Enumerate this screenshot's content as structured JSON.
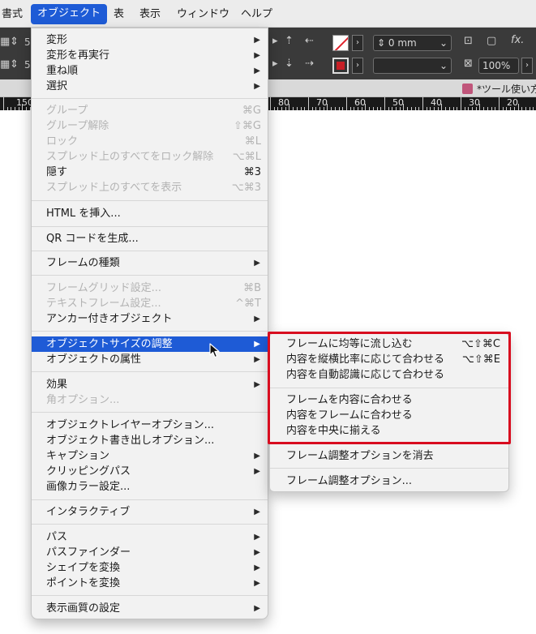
{
  "menubar": {
    "items": [
      {
        "label": "書式",
        "active": false
      },
      {
        "label": "オブジェクト",
        "active": true
      },
      {
        "label": "表",
        "active": false
      },
      {
        "label": "表示",
        "active": false
      },
      {
        "label": "ウィンドウ",
        "active": false
      },
      {
        "label": "ヘルプ",
        "active": false
      }
    ]
  },
  "control_panel": {
    "stroke_weight": "0 mm",
    "zoom": "100%",
    "fx_label": "fx.",
    "left_fields": [
      "5",
      "5"
    ]
  },
  "document_tab": {
    "title": "*ツール使い方"
  },
  "ruler": {
    "labels": [
      "150",
      "80",
      "70",
      "60",
      "50",
      "40",
      "30",
      "20"
    ]
  },
  "main_menu": {
    "items": [
      {
        "label": "変形",
        "shortcut": "",
        "submenu": true,
        "disabled": false,
        "highlighted": false
      },
      {
        "label": "変形を再実行",
        "shortcut": "",
        "submenu": true,
        "disabled": false,
        "highlighted": false
      },
      {
        "label": "重ね順",
        "shortcut": "",
        "submenu": true,
        "disabled": false,
        "highlighted": false
      },
      {
        "label": "選択",
        "shortcut": "",
        "submenu": true,
        "disabled": false,
        "highlighted": false
      },
      {
        "label": "グループ",
        "shortcut": "⌘G",
        "submenu": false,
        "disabled": true,
        "highlighted": false
      },
      {
        "label": "グループ解除",
        "shortcut": "⇧⌘G",
        "submenu": false,
        "disabled": true,
        "highlighted": false
      },
      {
        "label": "ロック",
        "shortcut": "⌘L",
        "submenu": false,
        "disabled": true,
        "highlighted": false
      },
      {
        "label": "スプレッド上のすべてをロック解除",
        "shortcut": "⌥⌘L",
        "submenu": false,
        "disabled": true,
        "highlighted": false
      },
      {
        "label": "隠す",
        "shortcut": "⌘3",
        "submenu": false,
        "disabled": false,
        "highlighted": false
      },
      {
        "label": "スプレッド上のすべてを表示",
        "shortcut": "⌥⌘3",
        "submenu": false,
        "disabled": true,
        "highlighted": false
      },
      {
        "label": "HTML を挿入...",
        "shortcut": "",
        "submenu": false,
        "disabled": false,
        "highlighted": false
      },
      {
        "label": "QR コードを生成...",
        "shortcut": "",
        "submenu": false,
        "disabled": false,
        "highlighted": false
      },
      {
        "label": "フレームの種類",
        "shortcut": "",
        "submenu": true,
        "disabled": false,
        "highlighted": false
      },
      {
        "label": "フレームグリッド設定...",
        "shortcut": "⌘B",
        "submenu": false,
        "disabled": true,
        "highlighted": false
      },
      {
        "label": "テキストフレーム設定...",
        "shortcut": "^⌘T",
        "submenu": false,
        "disabled": true,
        "highlighted": false
      },
      {
        "label": "アンカー付きオブジェクト",
        "shortcut": "",
        "submenu": true,
        "disabled": false,
        "highlighted": false
      },
      {
        "label": "オブジェクトサイズの調整",
        "shortcut": "",
        "submenu": true,
        "disabled": false,
        "highlighted": true
      },
      {
        "label": "オブジェクトの属性",
        "shortcut": "",
        "submenu": true,
        "disabled": false,
        "highlighted": false
      },
      {
        "label": "効果",
        "shortcut": "",
        "submenu": true,
        "disabled": false,
        "highlighted": false
      },
      {
        "label": "角オプション...",
        "shortcut": "",
        "submenu": false,
        "disabled": true,
        "highlighted": false
      },
      {
        "label": "オブジェクトレイヤーオプション...",
        "shortcut": "",
        "submenu": false,
        "disabled": false,
        "highlighted": false
      },
      {
        "label": "オブジェクト書き出しオプション...",
        "shortcut": "",
        "submenu": false,
        "disabled": false,
        "highlighted": false
      },
      {
        "label": "キャプション",
        "shortcut": "",
        "submenu": true,
        "disabled": false,
        "highlighted": false
      },
      {
        "label": "クリッピングパス",
        "shortcut": "",
        "submenu": true,
        "disabled": false,
        "highlighted": false
      },
      {
        "label": "画像カラー設定...",
        "shortcut": "",
        "submenu": false,
        "disabled": false,
        "highlighted": false
      },
      {
        "label": "インタラクティブ",
        "shortcut": "",
        "submenu": true,
        "disabled": false,
        "highlighted": false
      },
      {
        "label": "パス",
        "shortcut": "",
        "submenu": true,
        "disabled": false,
        "highlighted": false
      },
      {
        "label": "パスファインダー",
        "shortcut": "",
        "submenu": true,
        "disabled": false,
        "highlighted": false
      },
      {
        "label": "シェイプを変換",
        "shortcut": "",
        "submenu": true,
        "disabled": false,
        "highlighted": false
      },
      {
        "label": "ポイントを変換",
        "shortcut": "",
        "submenu": true,
        "disabled": false,
        "highlighted": false
      },
      {
        "label": "表示画質の設定",
        "shortcut": "",
        "submenu": true,
        "disabled": false,
        "highlighted": false
      }
    ]
  },
  "submenu": {
    "items": [
      {
        "label": "フレームに均等に流し込む",
        "shortcut": "⌥⇧⌘C"
      },
      {
        "label": "内容を縦横比率に応じて合わせる",
        "shortcut": "⌥⇧⌘E"
      },
      {
        "label": "内容を自動認識に応じて合わせる",
        "shortcut": ""
      },
      {
        "label": "フレームを内容に合わせる",
        "shortcut": ""
      },
      {
        "label": "内容をフレームに合わせる",
        "shortcut": ""
      },
      {
        "label": "内容を中央に揃える",
        "shortcut": ""
      },
      {
        "label": "フレーム調整オプションを消去",
        "shortcut": ""
      },
      {
        "label": "フレーム調整オプション...",
        "shortcut": ""
      }
    ]
  },
  "colors": {
    "highlight": "#1e5bd6",
    "annotation_box": "#d80c1f"
  },
  "icons": {
    "submenu_arrow": "▶"
  }
}
